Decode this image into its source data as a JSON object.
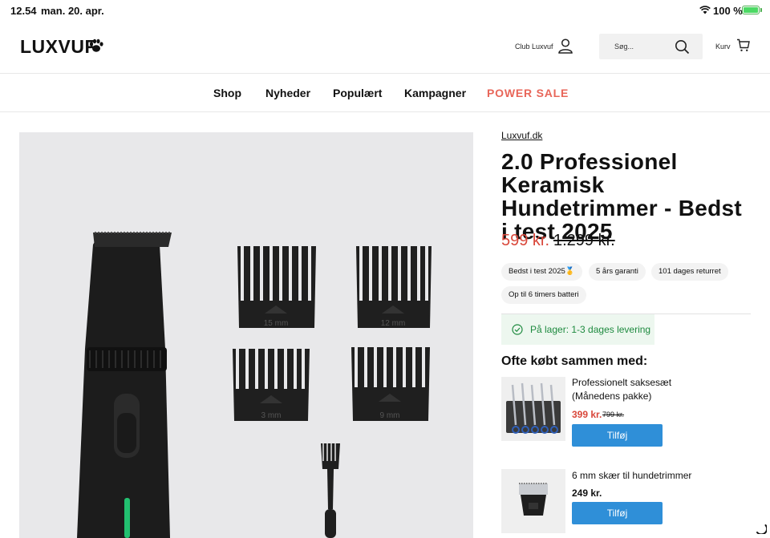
{
  "status_bar": {
    "time": "12.54",
    "date": "man. 20. apr.",
    "battery": "100 %"
  },
  "header": {
    "logo": "LUXVUF",
    "club_label": "Club Luxvuf",
    "search_placeholder": "Søg...",
    "cart_label": "Kurv"
  },
  "nav": {
    "items": [
      "Shop",
      "Nyheder",
      "Populært",
      "Kampagner",
      "POWER SALE"
    ]
  },
  "product": {
    "brand": "Luxvuf.dk",
    "title": "2.0 Professionel Keramisk Hundetrimmer - Bedst i test 2025",
    "price": "599 kr.",
    "old_price": "1.299 kr.",
    "badges": [
      "Bedst i test 2025🥇",
      "5 års garanti",
      "101 dages returret",
      "Op til 6 timers batteri"
    ],
    "stock": "På lager: 1-3 dages levering",
    "comb_labels": [
      "15 mm",
      "12 mm",
      "3 mm",
      "9 mm"
    ]
  },
  "often_bought": {
    "heading": "Ofte købt sammen med:",
    "items": [
      {
        "name": "Professionelt saksesæt (Månedens pakke)",
        "price": "399 kr.",
        "old_price": "799 kr.",
        "button": "Tilføj"
      },
      {
        "name": "6 mm skær til hundetrimmer",
        "price": "249 kr.",
        "button": "Tilføj"
      }
    ]
  },
  "colors": {
    "sale": "#e86659",
    "price": "#d9473a",
    "button": "#2f8fd8",
    "stock": "#1e8a3f"
  }
}
